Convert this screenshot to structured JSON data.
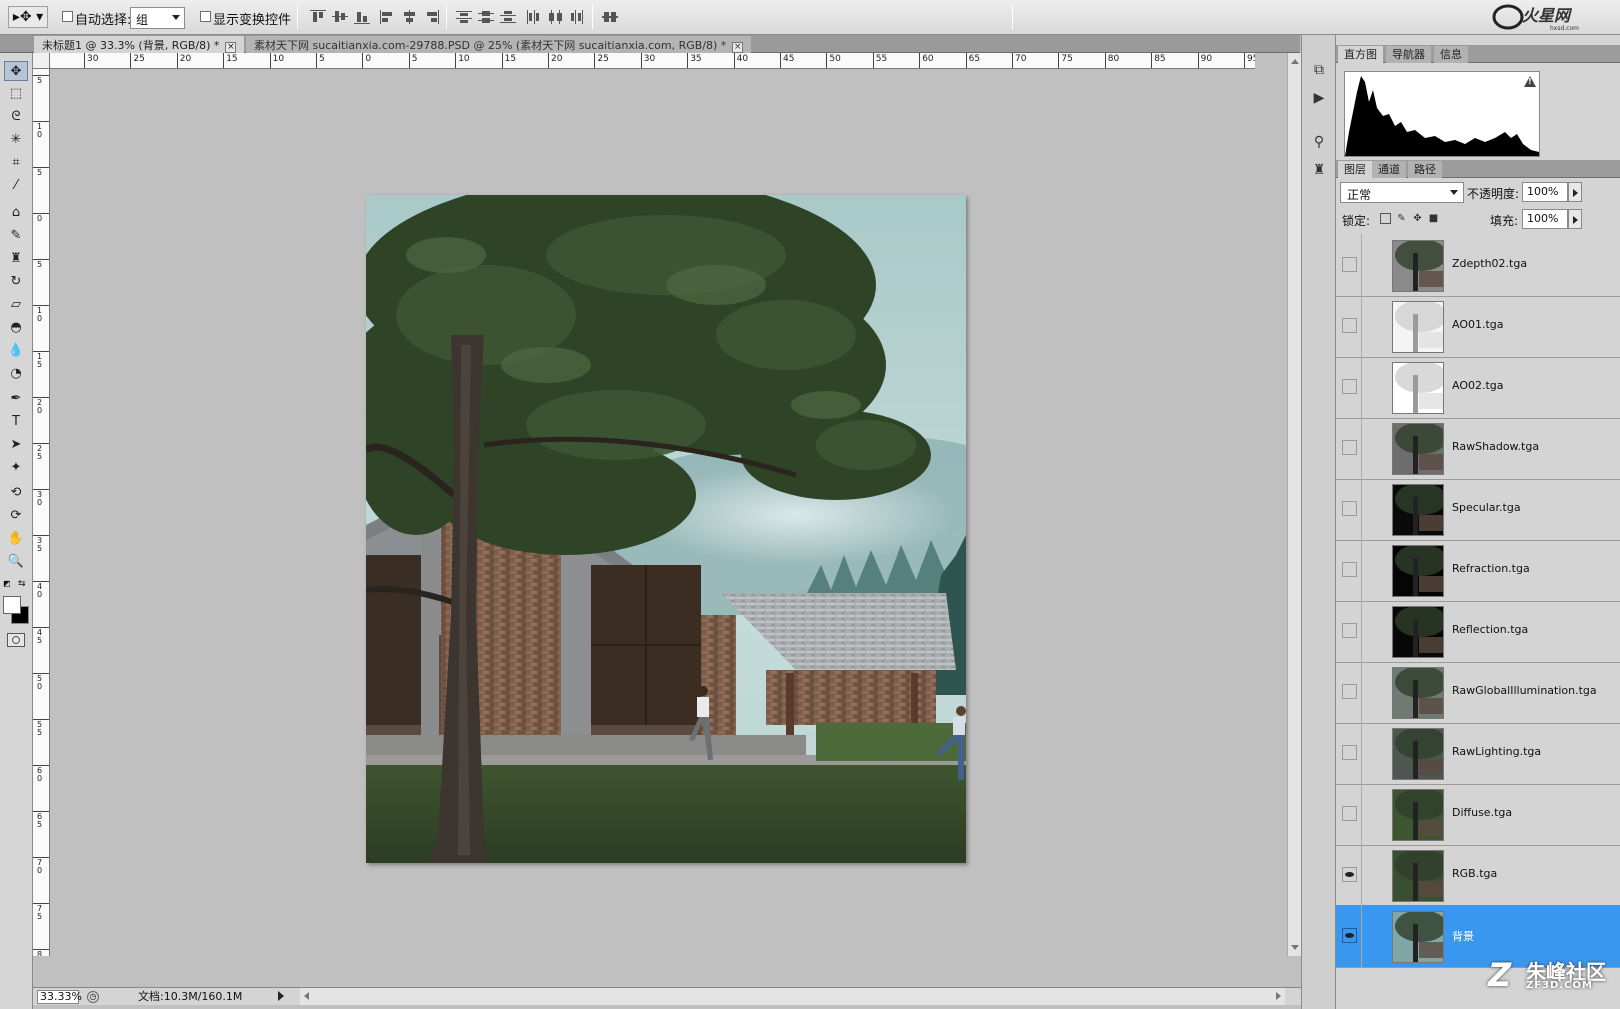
{
  "options_bar": {
    "auto_select_label": "自动选择:",
    "auto_select_value": "组",
    "show_transform_label": "显示变换控件",
    "brand_logo": "火星网 hxsd.com"
  },
  "tabs": [
    {
      "label": "未标题1 @ 33.3% (背景, RGB/8) *"
    },
    {
      "label": "素材天下网 sucaitianxia.com-29788.PSD @ 25% (素材天下网 sucaitianxia.com, RGB/8) *"
    }
  ],
  "ruler": {
    "h_labels": [
      "30",
      "25",
      "20",
      "15",
      "10",
      "5",
      "0",
      "5",
      "10",
      "15",
      "20",
      "25",
      "30",
      "35",
      "40",
      "45",
      "50",
      "55",
      "60",
      "65",
      "70",
      "75",
      "80",
      "85",
      "90",
      "95"
    ],
    "v_labels": [
      "5",
      "10",
      "5",
      "0",
      "5",
      "10",
      "15",
      "20",
      "25",
      "30",
      "35",
      "40",
      "45",
      "50",
      "55",
      "60",
      "65",
      "70",
      "75",
      "80",
      "8"
    ]
  },
  "status": {
    "zoom": "33.33%",
    "doc_info": "文档:10.3M/160.1M"
  },
  "panels": {
    "top_tabs": [
      "直方图",
      "导航器",
      "信息"
    ],
    "layer_tabs": [
      "图层",
      "通道",
      "路径"
    ],
    "blend_mode": "正常",
    "opacity_label": "不透明度:",
    "opacity_value": "100%",
    "lock_label": "锁定:",
    "fill_label": "填充:",
    "fill_value": "100%"
  },
  "layers": [
    {
      "name": "Zdepth02.tga",
      "visible": false
    },
    {
      "name": "AO01.tga",
      "visible": false
    },
    {
      "name": "AO02.tga",
      "visible": false
    },
    {
      "name": "RawShadow.tga",
      "visible": false
    },
    {
      "name": "Specular.tga",
      "visible": false
    },
    {
      "name": "Refraction.tga",
      "visible": false
    },
    {
      "name": "Reflection.tga",
      "visible": false
    },
    {
      "name": "RawGlobalIllumination.tga",
      "visible": false
    },
    {
      "name": "RawLighting.tga",
      "visible": false
    },
    {
      "name": "Diffuse.tga",
      "visible": false
    },
    {
      "name": "RGB.tga",
      "visible": true
    },
    {
      "name": "背景",
      "visible": true,
      "selected": true
    }
  ],
  "watermark": {
    "main": "朱峰社区",
    "sub": "ZF3D.COM",
    "letter": "Z"
  },
  "colors": {
    "selected_layer": "#3a97f0",
    "canvas_bg": "#c0c0c0"
  }
}
